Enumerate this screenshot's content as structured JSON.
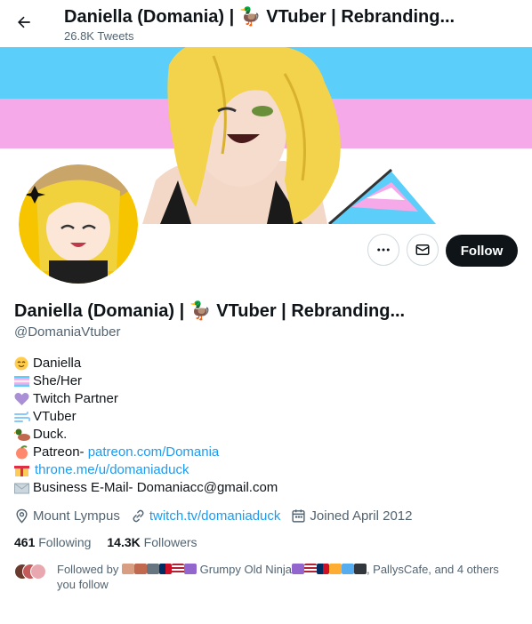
{
  "header": {
    "title": "Daniella (Domania) | 🦆 VTuber | Rebranding...",
    "tweet_count": "26.8K Tweets"
  },
  "profile": {
    "name": "Daniella (Domania) | 🦆 VTuber | Rebranding...",
    "handle": "@DomaniaVtuber",
    "follow_label": "Follow"
  },
  "bio": {
    "line1": "Daniella",
    "line2": "She/Her",
    "line3": "Twitch Partner",
    "line4": "VTuber",
    "line5": "Duck.",
    "line6_prefix": "Patreon- ",
    "line6_link": "patreon.com/Domania",
    "line7_link": "throne.me/u/domaniaduck",
    "line8": "Business E-Mail- Domaniacc@gmail.com"
  },
  "meta": {
    "location": "Mount Lympus",
    "website": "twitch.tv/domaniaduck",
    "joined": "Joined April 2012"
  },
  "stats": {
    "following_count": "461",
    "following_label": "Following",
    "followers_count": "14.3K",
    "followers_label": "Followers"
  },
  "followed_by": {
    "prefix": "Followed by",
    "name1": "Grumpy Old Ninja",
    "suffix": ", PallysCafe, and 4 others you follow"
  },
  "colors": {
    "trans_blue": "#5bcefa",
    "trans_pink": "#f5a9e8",
    "follow_bg": "#0f1419",
    "link": "#1d9bf0",
    "muted": "#536471"
  },
  "icons": [
    "back-arrow-icon",
    "more-icon",
    "mail-icon",
    "location-icon",
    "link-icon",
    "calendar-icon"
  ]
}
